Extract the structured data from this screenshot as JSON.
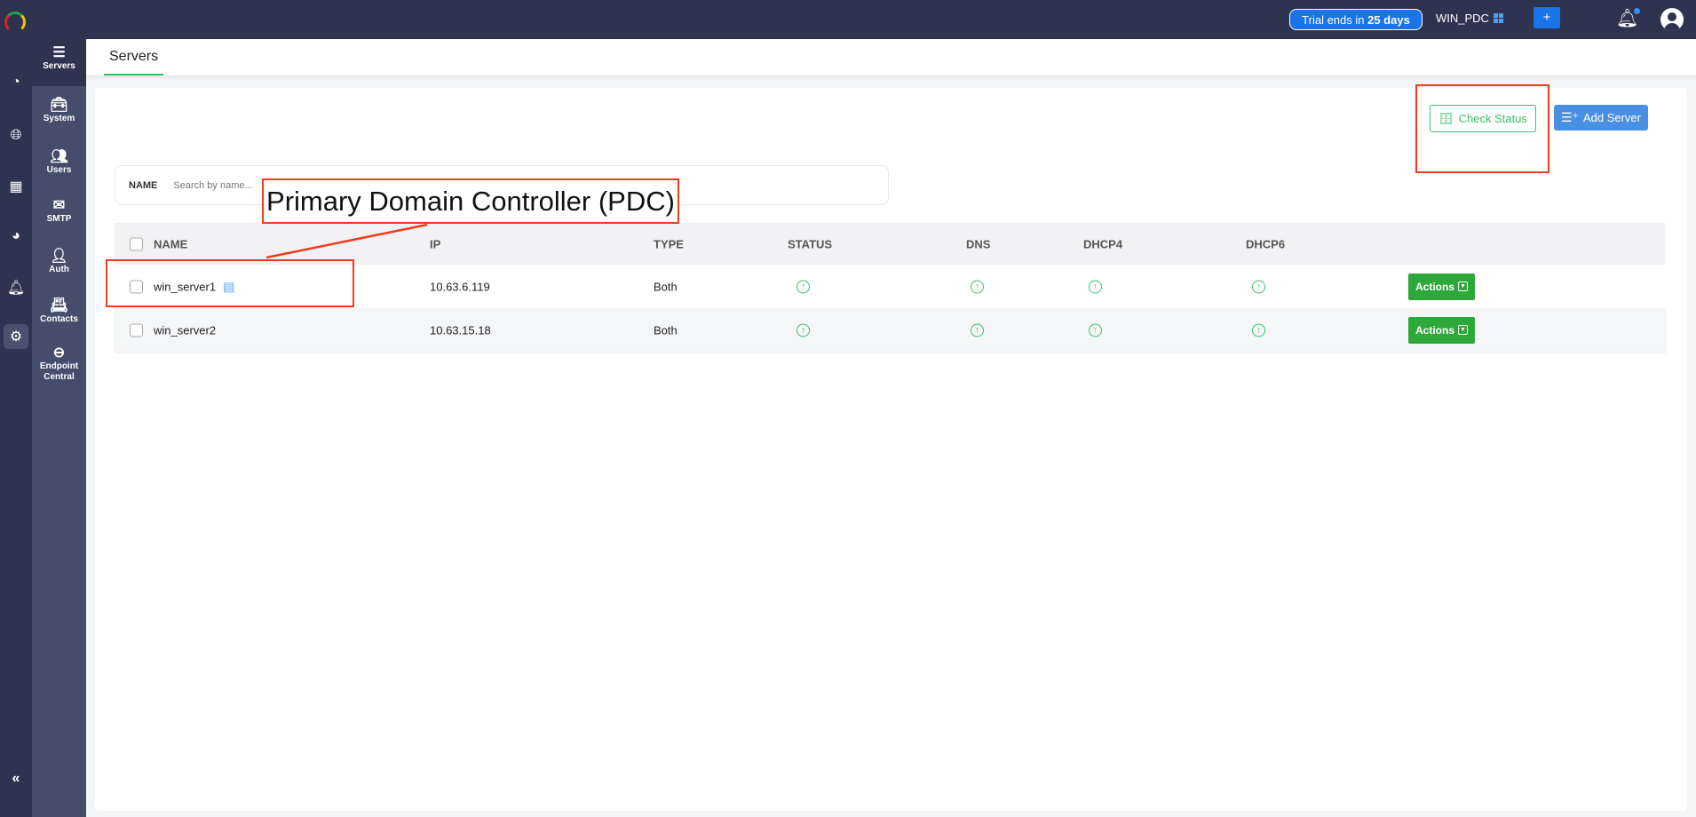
{
  "topbar": {
    "trial_prefix": "Trial ends in ",
    "trial_days": "25 days",
    "server_name": "WIN_PDC",
    "plus_label": "+"
  },
  "sidebar": {
    "items": [
      {
        "label": "Servers"
      },
      {
        "label": "System"
      },
      {
        "label": "Users"
      },
      {
        "label": "SMTP"
      },
      {
        "label": "Auth"
      },
      {
        "label": "Contacts"
      },
      {
        "label": "Endpoint Central"
      }
    ],
    "collapse": "«"
  },
  "tabs": {
    "active": "Servers"
  },
  "toolbar": {
    "check_status": "Check Status",
    "add_server": "Add Server"
  },
  "search": {
    "label": "NAME",
    "placeholder": "Search by name..."
  },
  "table": {
    "headers": [
      "NAME",
      "IP",
      "TYPE",
      "STATUS",
      "DNS",
      "DHCP4",
      "DHCP6"
    ],
    "rows": [
      {
        "name": "win_server1",
        "ip": "10.63.6.119",
        "type": "Both",
        "action": "Actions"
      },
      {
        "name": "win_server2",
        "ip": "10.63.15.18",
        "type": "Both",
        "action": "Actions"
      }
    ]
  },
  "annotation": {
    "text": "Primary Domain Controller (PDC)"
  }
}
